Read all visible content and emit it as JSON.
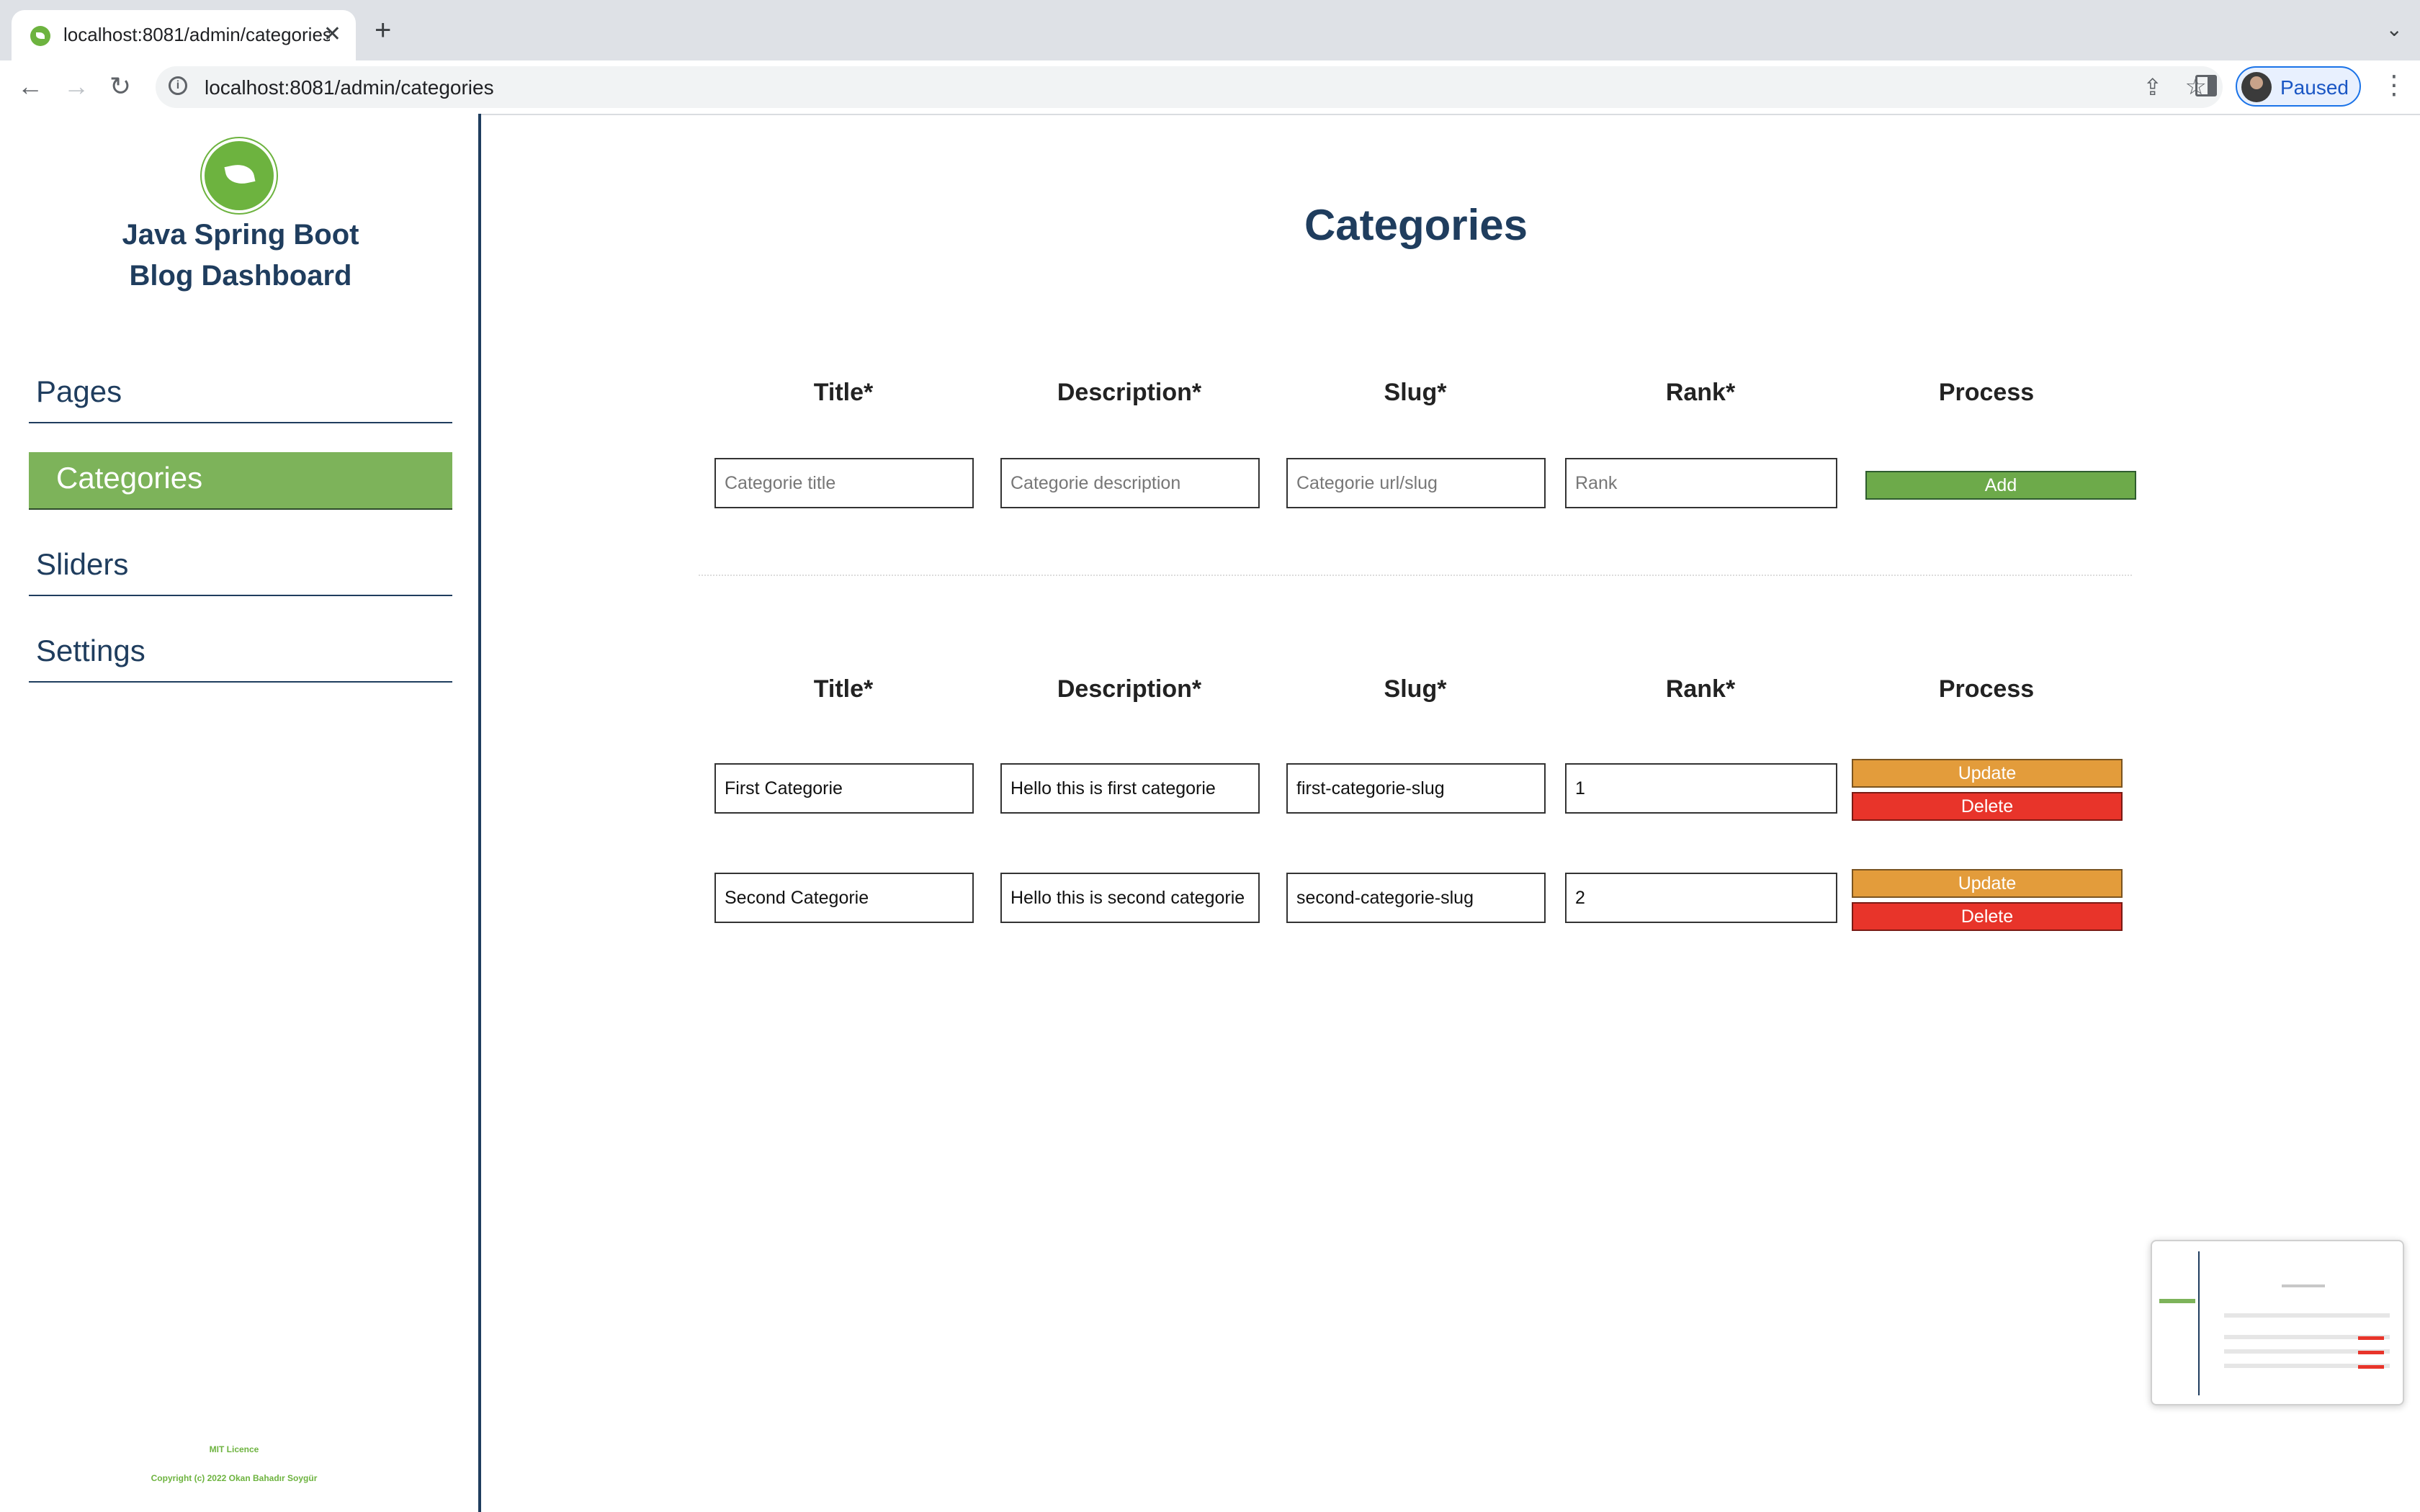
{
  "browser": {
    "tab_title": "localhost:8081/admin/categories",
    "tab_close": "✕",
    "new_tab": "+",
    "url": "localhost:8081/admin/categories",
    "profile_status": "Paused"
  },
  "sidebar": {
    "brand_line1": "Java Spring Boot",
    "brand_line2": "Blog Dashboard",
    "items": [
      {
        "label": "Pages",
        "active": false
      },
      {
        "label": "Categories",
        "active": true
      },
      {
        "label": "Sliders",
        "active": false
      },
      {
        "label": "Settings",
        "active": false
      }
    ],
    "licence": "MIT Licence",
    "copyright": "Copyright (c) 2022 Okan Bahadır Soygür"
  },
  "main": {
    "title": "Categories",
    "columns": [
      "Title*",
      "Description*",
      "Slug*",
      "Rank*",
      "Process"
    ],
    "new_form": {
      "title_placeholder": "Categorie title",
      "description_placeholder": "Categorie description",
      "slug_placeholder": "Categorie url/slug",
      "rank_placeholder": "Rank",
      "add_label": "Add"
    },
    "rows": [
      {
        "title": "First Categorie",
        "description": "Hello this is first categorie",
        "slug": "first-categorie-slug",
        "rank": "1",
        "update_label": "Update",
        "delete_label": "Delete"
      },
      {
        "title": "Second Categorie",
        "description": "Hello this is second categorie",
        "slug": "second-categorie-slug",
        "rank": "2",
        "update_label": "Update",
        "delete_label": "Delete"
      }
    ]
  },
  "colors": {
    "brand_navy": "#1f3d5e",
    "spring_green": "#6db33f",
    "active_menu": "#7db35a",
    "update_orange": "#e39c3b",
    "delete_red": "#e8342a"
  }
}
